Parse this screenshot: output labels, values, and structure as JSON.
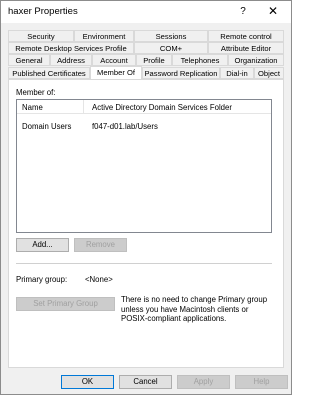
{
  "window": {
    "title": "haxer Properties"
  },
  "titlebar": {
    "help_label": "?",
    "close_label": "✕"
  },
  "tabs": {
    "row1": [
      "Security",
      "Environment",
      "Sessions",
      "Remote control"
    ],
    "row2": [
      "Remote Desktop Services Profile",
      "COM+",
      "Attribute Editor"
    ],
    "row3": [
      "General",
      "Address",
      "Account",
      "Profile",
      "Telephones",
      "Organization"
    ],
    "row4": [
      "Published Certificates",
      "Member Of",
      "Password Replication",
      "Dial-in",
      "Object"
    ],
    "active": "Member Of"
  },
  "member_of": {
    "label": "Member of:",
    "columns": [
      "Name",
      "Active Directory Domain Services Folder"
    ],
    "rows": [
      {
        "name": "Domain Users",
        "folder": "f047-d01.lab/Users"
      }
    ],
    "add_label": "Add...",
    "remove_label": "Remove"
  },
  "primary_group": {
    "label": "Primary group:",
    "value": "<None>",
    "set_label": "Set Primary Group",
    "info": "There is no need to change Primary group unless you have Macintosh clients or POSIX-compliant applications."
  },
  "footer": {
    "ok": "OK",
    "cancel": "Cancel",
    "apply": "Apply",
    "help": "Help"
  }
}
